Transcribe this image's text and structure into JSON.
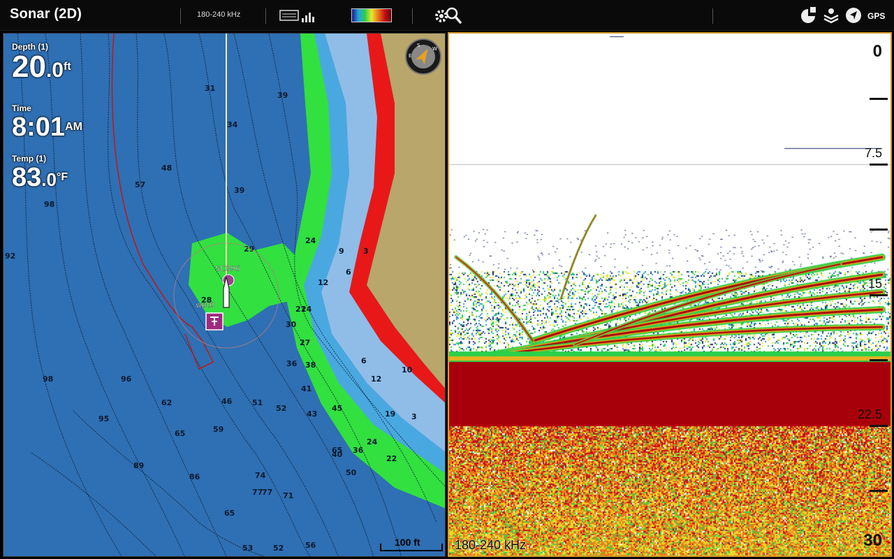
{
  "header": {
    "title": "Sonar (2D)",
    "frequency": "180-240 kHz",
    "gps_label": "GPS"
  },
  "icons": {
    "mode": "sonar-mode-icon",
    "palette": "color-palette-icon",
    "settings": "settings-search-icon",
    "right": [
      "pie-chart-icon",
      "layers-icon",
      "navigation-arrow-icon",
      "gps-icon"
    ]
  },
  "readouts": {
    "depth_label": "Depth (1)",
    "depth_value": "20",
    "depth_decimal": ".0",
    "depth_unit": "ft",
    "time_label": "Time",
    "time_value": "8:01",
    "time_ampm": "AM",
    "temp_label": "Temp (1)",
    "temp_value": "83",
    "temp_decimal": ".0",
    "temp_unit": "°F"
  },
  "map": {
    "scale_label": "100 ft",
    "waypoint_label": "SC896",
    "waypoint2_label": "wpt0",
    "contour_labels": [
      "31",
      "39",
      "34",
      "39",
      "48",
      "57",
      "98",
      "92",
      "29",
      "28",
      "24",
      "9",
      "6",
      "3",
      "12",
      "21",
      "27",
      "30",
      "24",
      "36",
      "38",
      "41",
      "43",
      "45",
      "46",
      "51",
      "52",
      "59",
      "62",
      "65",
      "74",
      "77",
      "86",
      "89",
      "95",
      "96",
      "98",
      "65",
      "56",
      "53",
      "52",
      "77",
      "71",
      "65",
      "50",
      "40",
      "36",
      "24",
      "22",
      "19",
      "12",
      "10",
      "3",
      "6"
    ]
  },
  "sonar": {
    "frequency_label": "180-240 kHz",
    "depth_scale": [
      "0",
      "7.5",
      "15",
      "22.5",
      "30"
    ],
    "colors": {
      "accent_border": "#d79b2a",
      "bottom_red": "#a8000a"
    }
  }
}
